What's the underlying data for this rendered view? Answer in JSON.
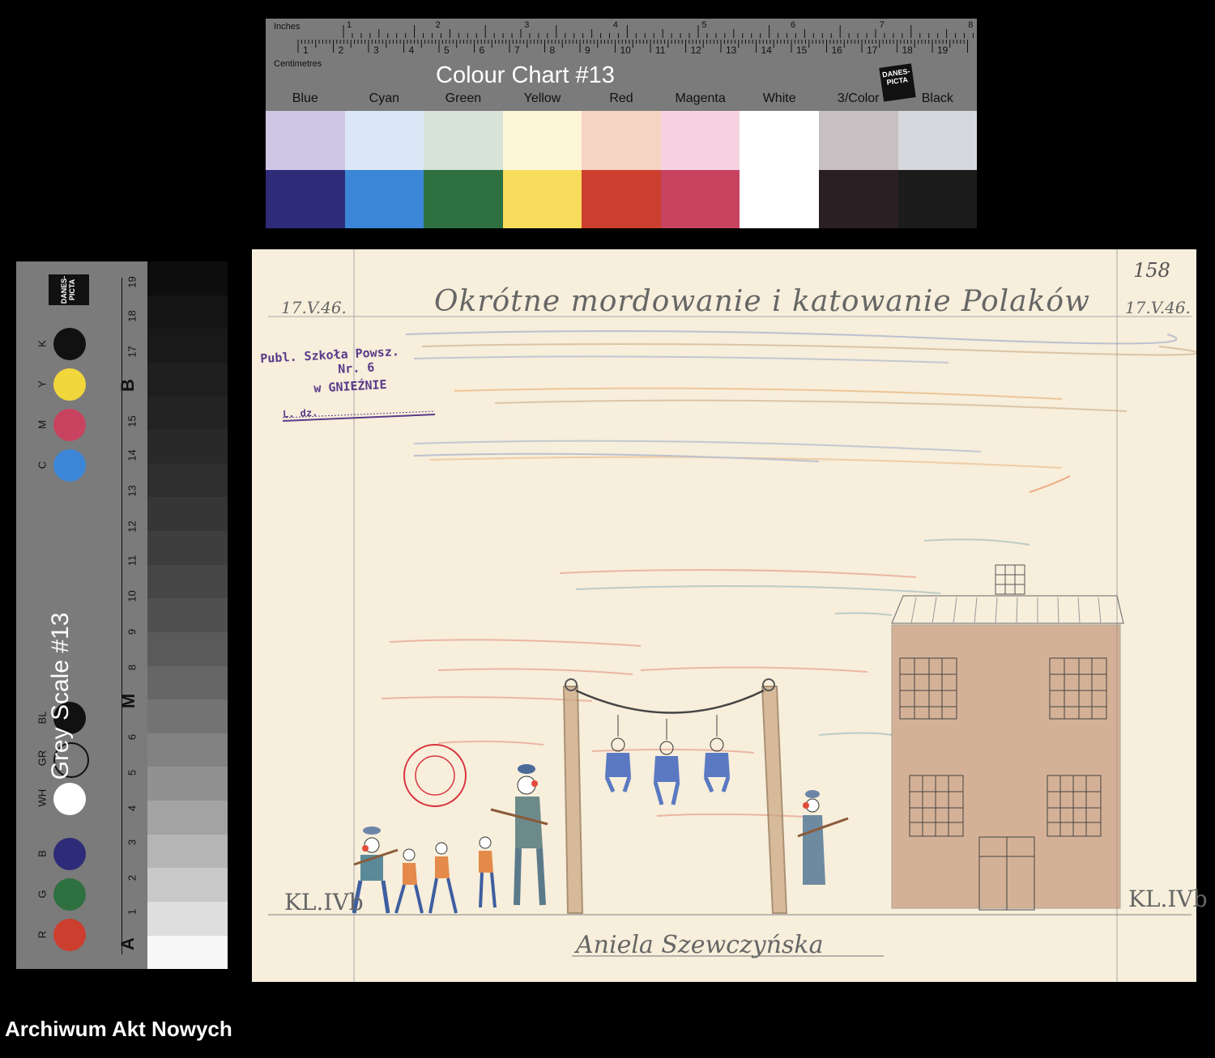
{
  "colour_chart": {
    "title": "Colour Chart #13",
    "inches_label": "Inches",
    "centimetres_label": "Centimetres",
    "inch_numbers": [
      "1",
      "2",
      "3",
      "4",
      "5",
      "6",
      "7",
      "8"
    ],
    "cm_numbers": [
      "1",
      "2",
      "3",
      "4",
      "5",
      "6",
      "7",
      "8",
      "9",
      "10",
      "11",
      "12",
      "13",
      "14",
      "15",
      "16",
      "17",
      "18",
      "19"
    ],
    "logo_text": "DANES-PICTA",
    "swatches": [
      {
        "name": "Blue",
        "light": "#cfc6e6",
        "dark": "#2e2b78"
      },
      {
        "name": "Cyan",
        "light": "#dbe7f7",
        "dark": "#3b86d6"
      },
      {
        "name": "Green",
        "light": "#d6e3d6",
        "dark": "#2f7040"
      },
      {
        "name": "Yellow",
        "light": "#fdf6d7",
        "dark": "#f8dc5c"
      },
      {
        "name": "Red",
        "light": "#f6d4c4",
        "dark": "#cc3e2e"
      },
      {
        "name": "Magenta",
        "light": "#f7d3e2",
        "dark": "#c8435f"
      },
      {
        "name": "White",
        "light": "#ffffff",
        "dark": "#ffffff"
      },
      {
        "name": "3/Color",
        "light": "#c8bfc2",
        "dark": "#2a2024"
      },
      {
        "name": "Black",
        "light": "#d6d8dd",
        "dark": "#1c1c1c"
      }
    ]
  },
  "grey_scale": {
    "title": "Grey Scale #13",
    "logo_text": "DANES-PICTA",
    "dots": [
      {
        "label": "K",
        "color": "#111111"
      },
      {
        "label": "Y",
        "color": "#f1d63c"
      },
      {
        "label": "M",
        "color": "#c8435f"
      },
      {
        "label": "C",
        "color": "#3b86d6"
      },
      {
        "label": "BL",
        "color": "#111111"
      },
      {
        "label": "GR",
        "color": "#7b7b7b"
      },
      {
        "label": "WH",
        "color": "#ffffff"
      },
      {
        "label": "B",
        "color": "#2e2b78"
      },
      {
        "label": "G",
        "color": "#2f7040"
      },
      {
        "label": "R",
        "color": "#cc3e2e"
      }
    ],
    "numbers": [
      "19",
      "18",
      "17",
      "15",
      "14",
      "13",
      "12",
      "11",
      "10",
      "9",
      "8",
      "6",
      "5",
      "4",
      "3",
      "2",
      "1"
    ],
    "letters": [
      "B",
      "M",
      "A"
    ],
    "steps": [
      "#0d0d0d",
      "#141414",
      "#191919",
      "#1e1e1e",
      "#232323",
      "#292929",
      "#2f2f2f",
      "#363636",
      "#3e3e3e",
      "#464646",
      "#505050",
      "#5a5a5a",
      "#666666",
      "#737373",
      "#828282",
      "#919191",
      "#a3a3a3",
      "#b5b5b5",
      "#c9c9c9",
      "#dedede",
      "#f7f7f7"
    ]
  },
  "drawing": {
    "date_left": "17.V.46.",
    "date_right": "17.V.46.",
    "page_number": "158",
    "title": "Okrótne mordowanie i katowanie Polaków",
    "stamp_line1": "Publ. Szkoła Powsz.",
    "stamp_line2": "Nr. 6",
    "stamp_line3": "w GNIEŹNIE",
    "stamp_line4": "L. dz.",
    "class_left": "KL.IVb",
    "class_right": "KL.IVb",
    "signature": "Aniela Szewczyńska"
  },
  "footer": {
    "archive": "Archiwum Akt Nowych"
  }
}
